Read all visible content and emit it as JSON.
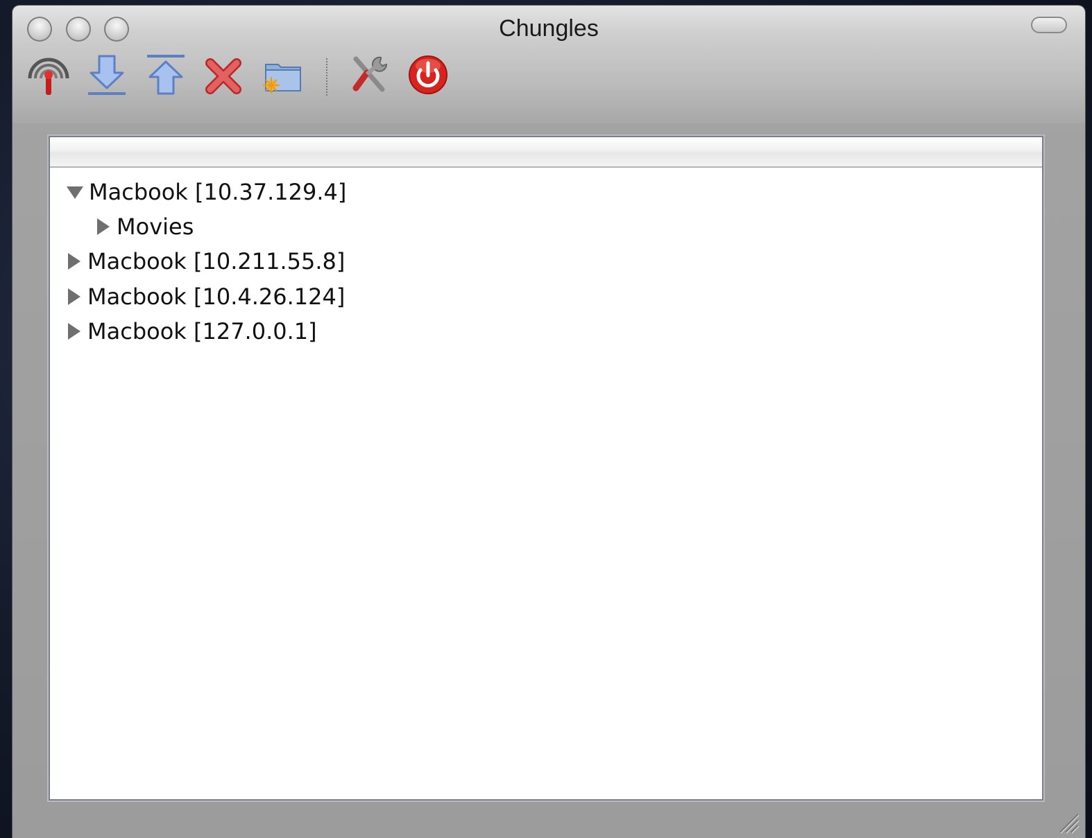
{
  "window": {
    "title": "Chungles"
  },
  "toolbar": {
    "buttons": [
      {
        "name": "broadcast-button",
        "icon": "broadcast-antenna-icon"
      },
      {
        "name": "download-button",
        "icon": "download-arrow-icon"
      },
      {
        "name": "upload-button",
        "icon": "upload-arrow-icon"
      },
      {
        "name": "delete-button",
        "icon": "red-x-icon"
      },
      {
        "name": "new-folder-button",
        "icon": "new-folder-icon"
      },
      {
        "name": "preferences-button",
        "icon": "tools-icon"
      },
      {
        "name": "quit-button",
        "icon": "power-icon"
      }
    ]
  },
  "tree": {
    "items": [
      {
        "label": "Macbook [10.37.129.4]",
        "expanded": true,
        "level": 0
      },
      {
        "label": "Movies",
        "expanded": false,
        "level": 1
      },
      {
        "label": "Macbook [10.211.55.8]",
        "expanded": false,
        "level": 0
      },
      {
        "label": "Macbook [10.4.26.124]",
        "expanded": false,
        "level": 0
      },
      {
        "label": "Macbook [127.0.0.1]",
        "expanded": false,
        "level": 0
      }
    ]
  },
  "colors": {
    "disclosure": "#6f6f6f",
    "delete_red": "#e23a3a",
    "arrow_blue": "#7fa4e6",
    "power_red": "#d7241e"
  }
}
